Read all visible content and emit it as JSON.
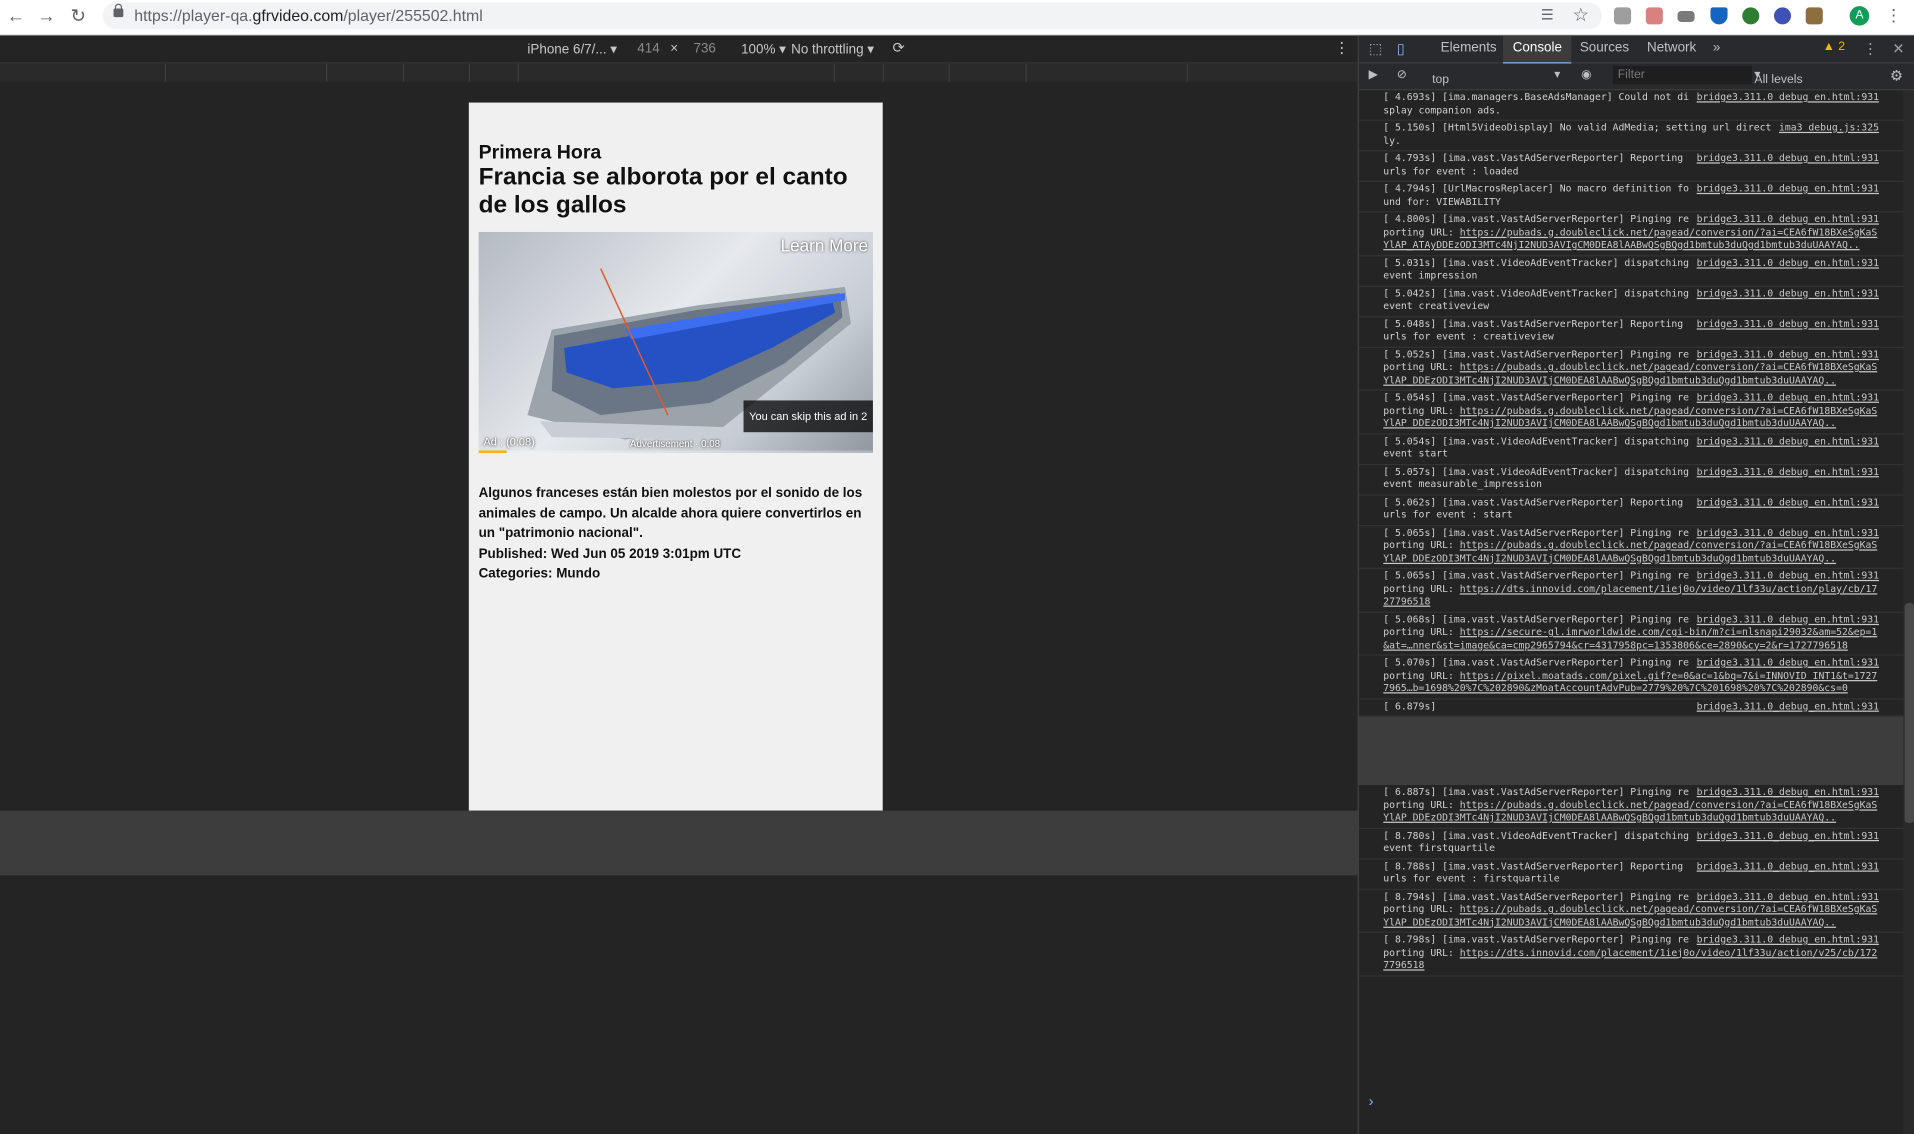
{
  "browser": {
    "url_prefix": "https://player-qa.",
    "url_domain": "gfrvideo.com",
    "url_path": "/player/255502.html",
    "avatar_letter": "A"
  },
  "device_toolbar": {
    "device": "iPhone 6/7/...",
    "width": "414",
    "height": "736",
    "zoom": "100%",
    "throttling": "No throttling"
  },
  "page": {
    "brand": "Primera Hora",
    "headline": "Francia se alborota por el canto de los gallos",
    "video": {
      "learn_more": "Learn More",
      "skip_text": "You can skip this ad in 2",
      "ad_label": "Ad : (0:08)",
      "advertisement": "Advertisement · 0:08",
      "progress": 0.07
    },
    "description": "Algunos franceses están bien molestos por el sonido de los animales de campo. Un alcalde ahora quiere convertirlos en un \"patrimonio nacional\".",
    "published": "Published: Wed Jun 05 2019 3:01pm UTC",
    "categories": "Categories: Mundo"
  },
  "devtools": {
    "tabs": [
      "Elements",
      "Console",
      "Sources",
      "Network"
    ],
    "more": "»",
    "warnings": "2",
    "context": "top",
    "filter_placeholder": "Filter",
    "levels": "All levels",
    "logs": [
      {
        "t": "[ 4.693s] [ima.managers.BaseAdsManager] Could not display companion ads.",
        "src": "bridge3.311.0_debug_en.html:931"
      },
      {
        "t": "[ 5.150s] [Html5VideoDisplay] No valid AdMedia; setting url directly.",
        "src": "ima3_debug.js:325"
      },
      {
        "t": "[ 4.793s] [ima.vast.VastAdServerReporter] Reporting urls for event : loaded",
        "src": "bridge3.311.0_debug_en.html:931"
      },
      {
        "t": "[ 4.794s] [UrlMacrosReplacer] No macro definition found for: VIEWABILITY",
        "src": "bridge3.311.0_debug_en.html:931"
      },
      {
        "t": "[ 4.800s] [ima.vast.VastAdServerReporter] Pinging reporting URL: ",
        "link": "https://pubads.g.doubleclick.net/pagead/conversion/?ai=CEA6fW18BXeSgKaSYlAP_ATAyDDEzODI3MTc4NjI2NUD3AVIgCM0DEA8lAABwQSgBQgd1bmtub3duQgd1bmtub3duUAAYAQ..",
        "src": "bridge3.311.0_debug_en.html:931"
      },
      {
        "t": "[ 5.031s] [ima.vast.VideoAdEventTracker] dispatching event impression",
        "src": "bridge3.311.0_debug_en.html:931"
      },
      {
        "t": "[ 5.042s] [ima.vast.VideoAdEventTracker] dispatching event creativeview",
        "src": "bridge3.311.0_debug_en.html:931"
      },
      {
        "t": "[ 5.048s] [ima.vast.VastAdServerReporter] Reporting urls for event : creativeview",
        "src": "bridge3.311.0_debug_en.html:931"
      },
      {
        "t": "[ 5.052s] [ima.vast.VastAdServerReporter] Pinging reporting URL: ",
        "link": "https://pubads.g.doubleclick.net/pagead/conversion/?ai=CEA6fW18BXeSgKaSYlAP_DDEzODI3MTc4NjI2NUD3AVIjCM0DEA8lAABwQSgBQgd1bmtub3duQgd1bmtub3duUAAYAQ..",
        "src": "bridge3.311.0_debug_en.html:931"
      },
      {
        "t": "[ 5.054s] [ima.vast.VastAdServerReporter] Pinging reporting URL: ",
        "link": "https://pubads.g.doubleclick.net/pagead/conversion/?ai=CEA6fW18BXeSgKaSYlAP_DDEzODI3MTc4NjI2NUD3AVIjCM0DEA8lAABwQSgBQgd1bmtub3duQgd1bmtub3duUAAYAQ..",
        "src": "bridge3.311.0_debug_en.html:931"
      },
      {
        "t": "[ 5.054s] [ima.vast.VideoAdEventTracker] dispatching event start",
        "src": "bridge3.311.0_debug_en.html:931"
      },
      {
        "t": "[ 5.057s] [ima.vast.VideoAdEventTracker] dispatching event measurable_impression",
        "src": "bridge3.311.0_debug_en.html:931"
      },
      {
        "t": "[ 5.062s] [ima.vast.VastAdServerReporter] Reporting urls for event : start",
        "src": "bridge3.311.0_debug_en.html:931"
      },
      {
        "t": "[ 5.065s] [ima.vast.VastAdServerReporter] Pinging reporting URL: ",
        "link": "https://pubads.g.doubleclick.net/pagead/conversion/?ai=CEA6fW18BXeSgKaSYlAP_DDEzODI3MTc4NjI2NUD3AVIjCM0DEA8lAABwQSgBQgd1bmtub3duQgd1bmtub3duUAAYAQ..",
        "src": "bridge3.311.0_debug_en.html:931"
      },
      {
        "t": "[ 5.065s] [ima.vast.VastAdServerReporter] Pinging reporting URL: ",
        "link": "https://dts.innovid.com/placement/1iej0o/video/1lf33u/action/play/cb/1727796518",
        "src": "bridge3.311.0_debug_en.html:931"
      },
      {
        "t": "[ 5.068s] [ima.vast.VastAdServerReporter] Pinging reporting URL: ",
        "link": "https://secure-gl.imrworldwide.com/cgi-bin/m?ci=nlsnapi29032&am=52&ep=1&at=…nner&st=image&ca=cmp2965794&cr=4317958pc=1353806&ce=2890&cy=2&r=1727796518",
        "src": "bridge3.311.0_debug_en.html:931"
      },
      {
        "t": "[ 5.070s] [ima.vast.VastAdServerReporter] Pinging reporting URL: ",
        "link": "https://pixel.moatads.com/pixel.gif?e=0&ac=1&bq=7&i=INNOVID_INT1&t=17277965…b=1698%20%7C%202890&zMoatAccountAdvPub=2779%20%7C%201698%20%7C%202890&cs=0",
        "src": "bridge3.311.0_debug_en.html:931"
      },
      {
        "t": "[ 6.879s]",
        "src": "bridge3.311.0_debug_en.html:931"
      }
    ],
    "logs_lower": [
      {
        "t": "[ 6.887s] [ima.vast.VastAdServerReporter] Pinging reporting URL: ",
        "link": "https://pubads.g.doubleclick.net/pagead/conversion/?ai=CEA6fW18BXeSgKaSYlAP_DDEzODI3MTc4NjI2NUD3AVIjCM0DEA8lAABwQSgBQgd1bmtub3duQgd1bmtub3duUAAYAQ..",
        "src": "bridge3.311.0_debug_en.html:931"
      },
      {
        "t": "[ 8.780s] [ima.vast.VideoAdEventTracker] dispatching event firstquartile",
        "src": "bridge3.311.0_debug_en.html:931"
      },
      {
        "t": "[ 8.788s] [ima.vast.VastAdServerReporter] Reporting urls for event : firstquartile",
        "src": "bridge3.311.0_debug_en.html:931"
      },
      {
        "t": "[ 8.794s] [ima.vast.VastAdServerReporter] Pinging reporting URL: ",
        "link": "https://pubads.g.doubleclick.net/pagead/conversion/?ai=CEA6fW18BXeSgKaSYlAP_DDEzODI3MTc4NjI2NUD3AVIjCM0DEA8lAABwQSgBQgd1bmtub3duQgd1bmtub3duUAAYAQ..",
        "src": "bridge3.311.0_debug_en.html:931"
      },
      {
        "t": "[ 8.798s] [ima.vast.VastAdServerReporter] Pinging reporting URL: ",
        "link": "https://dts.innovid.com/placement/1iej0o/video/1lf33u/action/v25/cb/1727796518",
        "src": "bridge3.311.0_debug_en.html:931"
      }
    ],
    "prompt": "›"
  }
}
